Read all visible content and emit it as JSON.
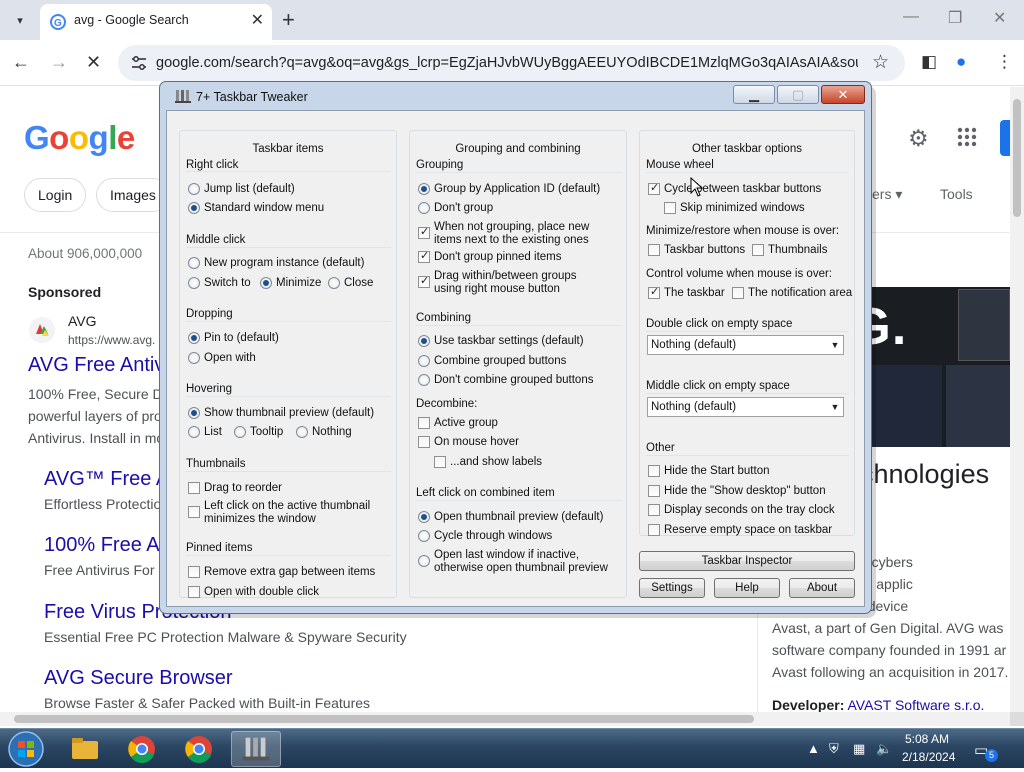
{
  "browser": {
    "tab_title": "avg - Google Search",
    "url": "google.com/search?q=avg&oq=avg&gs_lcrp=EgZjaHJvbWUyBggAEEUYOdIBCDE1MzlqMGo3qAIAsAIA&sourcei...",
    "icons": [
      "tab-search-icon",
      "google-g-icon",
      "close-icon",
      "plus-icon",
      "minimize-icon",
      "restore-icon",
      "back-arrow-icon",
      "forward-arrow-icon",
      "stop-icon",
      "site-info-icon",
      "star-icon",
      "side-panel-icon",
      "profile-icon",
      "menu-dots-icon"
    ]
  },
  "google": {
    "logo": "Google",
    "chips": [
      "Login",
      "Images"
    ],
    "chip_more": "ers",
    "tools": "Tools",
    "about": "About 906,000,000",
    "sponsored": "Sponsored",
    "ad_name": "AVG",
    "ad_url": "https://www.avg.",
    "ad_title": "AVG Free Antivi",
    "ad_text": [
      "100% Free, Secure D",
      "powerful layers of pro",
      "Antivirus. Install in mo"
    ],
    "results": [
      {
        "title": "AVG™ Free A",
        "text": "Effortless Protection"
      },
      {
        "title": "100% Free A",
        "text": "Free Antivirus For"
      },
      {
        "title": "Free Virus Protection",
        "text": "Essential Free PC Protection Malware & Spyware Security"
      },
      {
        "title": "AVG Secure Browser",
        "text": "Browse Faster & Safer Packed with Built-in Features"
      }
    ],
    "kp_logo": "AVG.",
    "kp_title": "chnologies",
    "kp_text": [
      "es is a brand of cybers",
      "d utility software applic",
      "ers and mobile device",
      "Avast, a part of Gen Digital. AVG was",
      "software company founded in 1991 ar",
      "Avast following an acquisition in 2017."
    ],
    "kp_dev_label": "Developer:",
    "kp_dev_value": "AVAST Software s.r.o."
  },
  "dialog": {
    "title": "7+ Taskbar Tweaker",
    "col1": {
      "header": "Taskbar items",
      "right_click": {
        "label": "Right click",
        "opt1": "Jump list (default)",
        "opt2": "Standard window menu"
      },
      "middle_click": {
        "label": "Middle click",
        "opt1": "New program instance (default)",
        "opt2": "Switch to",
        "opt3": "Minimize",
        "opt4": "Close"
      },
      "dropping": {
        "label": "Dropping",
        "opt1": "Pin to (default)",
        "opt2": "Open with"
      },
      "hovering": {
        "label": "Hovering",
        "opt1": "Show thumbnail preview (default)",
        "opt2": "List",
        "opt3": "Tooltip",
        "opt4": "Nothing"
      },
      "thumbnails": {
        "label": "Thumbnails",
        "opt1": "Drag to reorder",
        "opt2a": "Left click on the active thumbnail",
        "opt2b": "minimizes the window"
      },
      "pinned": {
        "label": "Pinned items",
        "opt1": "Remove extra gap between items",
        "opt2": "Open with double click"
      }
    },
    "col2": {
      "header": "Grouping and combining",
      "grouping": {
        "label": "Grouping",
        "opt1": "Group by Application ID (default)",
        "opt2": "Don't group",
        "opt3a": "When not grouping, place new",
        "opt3b": "items next to the existing ones",
        "opt4": "Don't group pinned items",
        "opt5a": "Drag within/between groups",
        "opt5b": "using right mouse button"
      },
      "combining": {
        "label": "Combining",
        "opt1": "Use taskbar settings (default)",
        "opt2": "Combine grouped buttons",
        "opt3": "Don't combine grouped buttons"
      },
      "decombine": {
        "label": "Decombine:",
        "opt1": "Active group",
        "opt2": "On mouse hover",
        "opt3": "...and show labels"
      },
      "leftclick": {
        "label": "Left click on combined item",
        "opt1": "Open thumbnail preview (default)",
        "opt2": "Cycle through windows",
        "opt3a": "Open last window if inactive,",
        "opt3b": "otherwise open thumbnail preview"
      }
    },
    "col3": {
      "header": "Other taskbar options",
      "mouse_wheel": {
        "label": "Mouse wheel",
        "opt1": "Cycle between taskbar buttons",
        "opt2": "Skip minimized windows"
      },
      "minimize": {
        "label": "Minimize/restore when mouse is over:",
        "opt1": "Taskbar buttons",
        "opt2": "Thumbnails"
      },
      "volume": {
        "label": "Control volume when mouse is over:",
        "opt1": "The taskbar",
        "opt2": "The notification area"
      },
      "dbl_click": {
        "label": "Double click on empty space",
        "value": "Nothing (default)"
      },
      "mid_click": {
        "label": "Middle click on empty space",
        "value": "Nothing (default)"
      },
      "other": {
        "label": "Other",
        "opt1": "Hide the Start button",
        "opt2": "Hide the \"Show desktop\" button",
        "opt3": "Display seconds on the tray clock",
        "opt4": "Reserve empty space on taskbar"
      }
    },
    "buttons": {
      "inspector": "Taskbar Inspector",
      "settings": "Settings",
      "help": "Help",
      "about": "About"
    }
  },
  "taskbar": {
    "time": "5:08 AM",
    "date": "2/18/2024",
    "notif_count": "5",
    "apps": [
      "folder-icon",
      "chrome-icon",
      "chrome-icon",
      "taskbar-tweaker-icon"
    ]
  },
  "colors": {
    "accent_blue": "#1a73e8",
    "link": "#1a0dab",
    "dialog_frame": "#c7d6e9",
    "close_red": "#c5452b",
    "taskbar": "#2b4663"
  }
}
